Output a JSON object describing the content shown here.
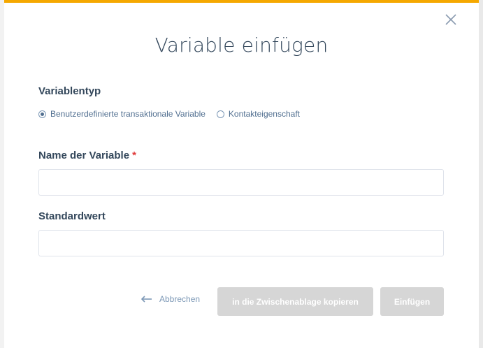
{
  "dialog": {
    "title": "Variable einfügen",
    "close_icon": "close-icon",
    "accent_color": "#f5a800"
  },
  "variable_type": {
    "label": "Variablentyp",
    "options": [
      {
        "label": "Benutzerdefinierte transaktionale Variable",
        "checked": true
      },
      {
        "label": "Kontakteigenschaft",
        "checked": false
      }
    ]
  },
  "variable_name": {
    "label": "Name der Variable",
    "required_marker": "*",
    "value": "",
    "placeholder": ""
  },
  "default_value": {
    "label": "Standardwert",
    "value": "",
    "placeholder": ""
  },
  "footer": {
    "cancel_label": "Abbrechen",
    "cancel_icon": "arrow-left-icon",
    "copy_label": "in die Zwischenablage kopieren",
    "insert_label": "Einfügen",
    "disabled_button_color": "#d6d6d6"
  }
}
